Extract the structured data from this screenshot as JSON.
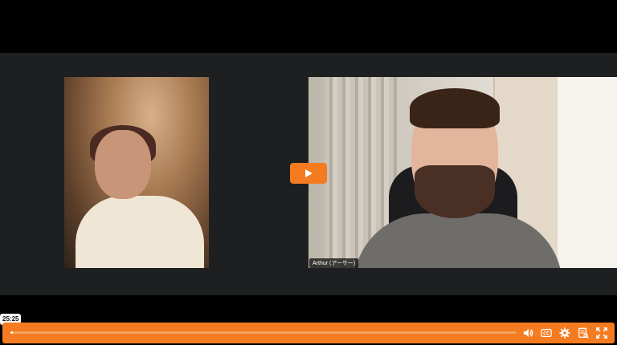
{
  "player": {
    "current_time": "25:25",
    "progress_fraction": 0.005,
    "accent_color": "#f47b20"
  },
  "participants": [
    {
      "name": ""
    },
    {
      "name": "Arthur (アーサー)"
    }
  ],
  "controls": {
    "icons": [
      "play-icon",
      "volume-icon",
      "captions-icon",
      "settings-icon",
      "transcript-icon",
      "fullscreen-icon"
    ]
  }
}
